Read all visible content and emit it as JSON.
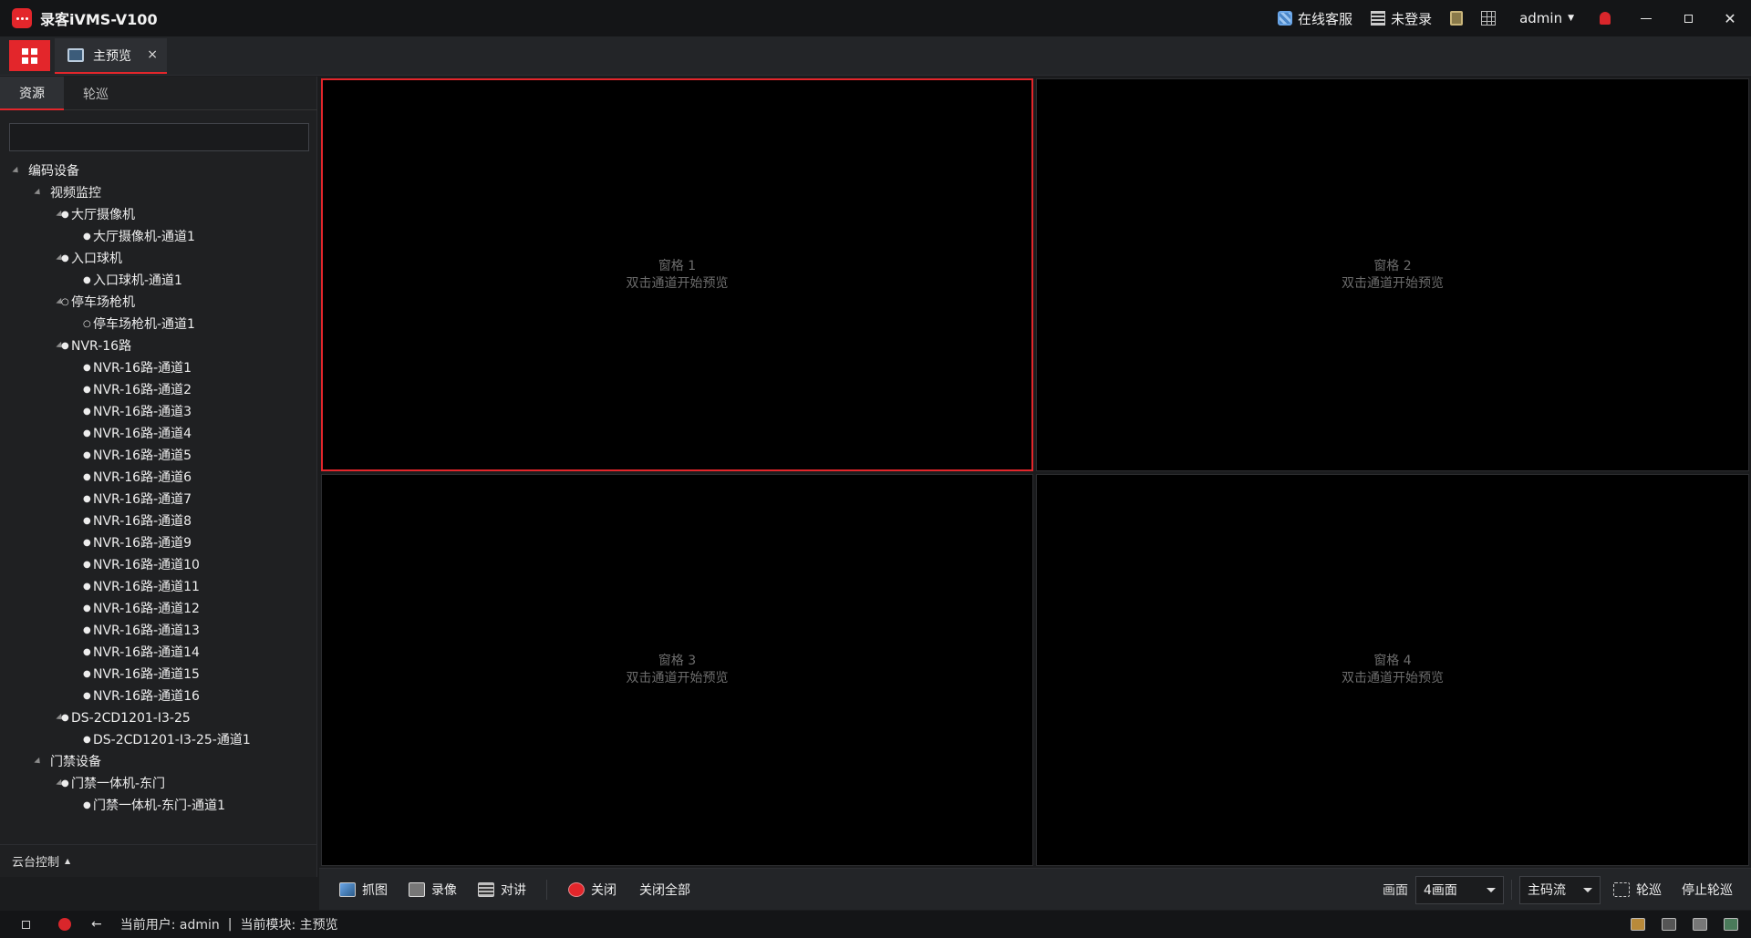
{
  "app": {
    "title": "录客iVMS-V100"
  },
  "titlebar": {
    "support_label": "在线客服",
    "login_label": "未登录",
    "user_label": "admin",
    "accent": "#e3262b"
  },
  "tabs": [
    {
      "label": "主预览",
      "close": "×"
    }
  ],
  "sidebar": {
    "tabs": [
      "资源",
      "轮巡"
    ],
    "search_placeholder": "",
    "tree": [
      {
        "label": "编码设备",
        "level": 0,
        "expand": true,
        "dot": ""
      },
      {
        "label": "视频监控",
        "level": 1,
        "expand": true,
        "dot": ""
      },
      {
        "label": "大厅摄像机",
        "level": 2,
        "expand": true,
        "dot": "●"
      },
      {
        "label": "大厅摄像机-通道1",
        "level": 3,
        "expand": false,
        "dot": "●"
      },
      {
        "label": "入口球机",
        "level": 2,
        "expand": true,
        "dot": "●"
      },
      {
        "label": "入口球机-通道1",
        "level": 3,
        "expand": false,
        "dot": "●"
      },
      {
        "label": "停车场枪机",
        "level": 2,
        "expand": true,
        "dot": "○"
      },
      {
        "label": "停车场枪机-通道1",
        "level": 3,
        "expand": false,
        "dot": "○"
      },
      {
        "label": "NVR-16路",
        "level": 2,
        "expand": true,
        "dot": "●"
      },
      {
        "label": "NVR-16路-通道1",
        "level": 3,
        "expand": false,
        "dot": "●"
      },
      {
        "label": "NVR-16路-通道2",
        "level": 3,
        "expand": false,
        "dot": "●"
      },
      {
        "label": "NVR-16路-通道3",
        "level": 3,
        "expand": false,
        "dot": "●"
      },
      {
        "label": "NVR-16路-通道4",
        "level": 3,
        "expand": false,
        "dot": "●"
      },
      {
        "label": "NVR-16路-通道5",
        "level": 3,
        "expand": false,
        "dot": "●"
      },
      {
        "label": "NVR-16路-通道6",
        "level": 3,
        "expand": false,
        "dot": "●"
      },
      {
        "label": "NVR-16路-通道7",
        "level": 3,
        "expand": false,
        "dot": "●"
      },
      {
        "label": "NVR-16路-通道8",
        "level": 3,
        "expand": false,
        "dot": "●"
      },
      {
        "label": "NVR-16路-通道9",
        "level": 3,
        "expand": false,
        "dot": "●"
      },
      {
        "label": "NVR-16路-通道10",
        "level": 3,
        "expand": false,
        "dot": "●"
      },
      {
        "label": "NVR-16路-通道11",
        "level": 3,
        "expand": false,
        "dot": "●"
      },
      {
        "label": "NVR-16路-通道12",
        "level": 3,
        "expand": false,
        "dot": "●"
      },
      {
        "label": "NVR-16路-通道13",
        "level": 3,
        "expand": false,
        "dot": "●"
      },
      {
        "label": "NVR-16路-通道14",
        "level": 3,
        "expand": false,
        "dot": "●"
      },
      {
        "label": "NVR-16路-通道15",
        "level": 3,
        "expand": false,
        "dot": "●"
      },
      {
        "label": "NVR-16路-通道16",
        "level": 3,
        "expand": false,
        "dot": "●"
      },
      {
        "label": "DS-2CD1201-I3-25",
        "level": 2,
        "expand": true,
        "dot": "●"
      },
      {
        "label": "DS-2CD1201-I3-25-通道1",
        "level": 3,
        "expand": false,
        "dot": "●"
      },
      {
        "label": "门禁设备",
        "level": 1,
        "expand": true,
        "dot": ""
      },
      {
        "label": "门禁一体机-东门",
        "level": 2,
        "expand": true,
        "dot": "●"
      },
      {
        "label": "门禁一体机-东门-通道1",
        "level": 3,
        "expand": false,
        "dot": "●"
      }
    ],
    "ptz_label": "云台控制"
  },
  "panes": [
    {
      "title": "窗格 1",
      "hint": "双击通道开始预览",
      "selected": true
    },
    {
      "title": "窗格 2",
      "hint": "双击通道开始预览",
      "selected": false
    },
    {
      "title": "窗格 3",
      "hint": "双击通道开始预览",
      "selected": false
    },
    {
      "title": "窗格 4",
      "hint": "双击通道开始预览",
      "selected": false
    }
  ],
  "toolbar": {
    "snapshot": "抓图",
    "record": "录像",
    "talk": "对讲",
    "close": "关闭",
    "close_all": "关闭全部",
    "layout_label": "画面",
    "layout_value": "4画面",
    "stream_value": "主码流",
    "patrol": "轮巡",
    "stop_patrol": "停止轮巡"
  },
  "status": {
    "user_text": "当前用户: admin",
    "module_text": "当前模块: 主预览",
    "divider": "|"
  }
}
